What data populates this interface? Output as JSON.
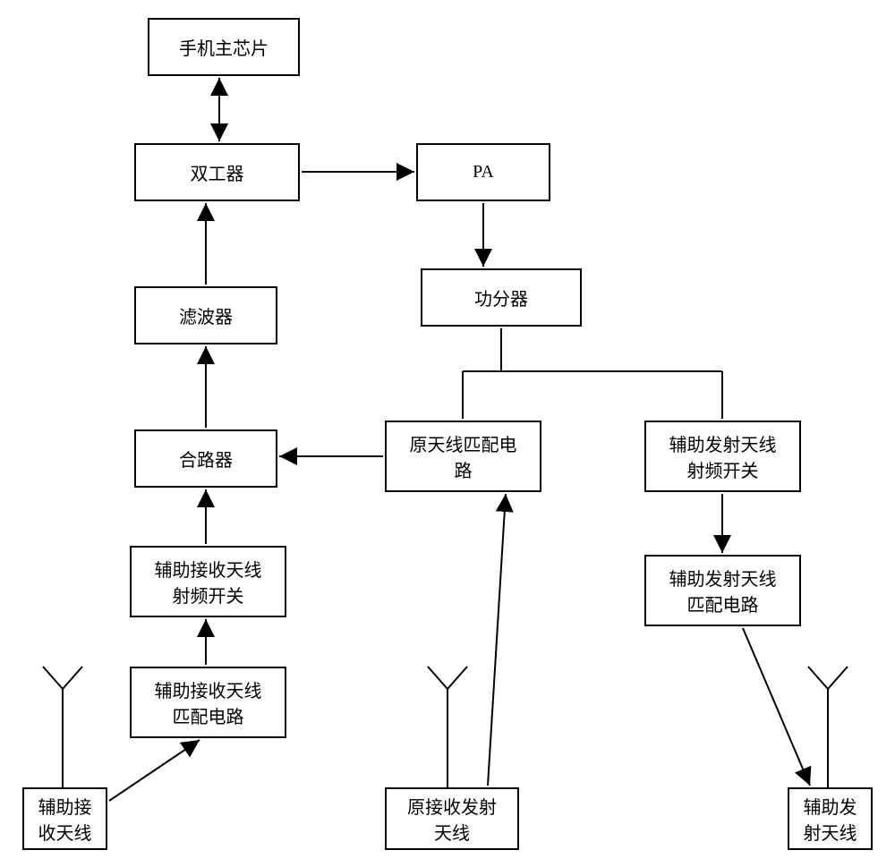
{
  "blocks": {
    "main_chip": "手机主芯片",
    "duplexer": "双工器",
    "pa": "PA",
    "splitter": "功分器",
    "filter": "滤波器",
    "combiner": "合路器",
    "orig_match": "原天线匹配电\n路",
    "aux_tx_sw": "辅助发射天线\n射频开关",
    "aux_rx_sw": "辅助接收天线\n射频开关",
    "aux_tx_match": "辅助发射天线\n匹配电路",
    "aux_rx_match": "辅助接收天线\n匹配电路",
    "aux_rx_ant": "辅助接\n收天线",
    "orig_ant": "原接收发射\n天线",
    "aux_tx_ant": "辅助发\n射天线"
  }
}
